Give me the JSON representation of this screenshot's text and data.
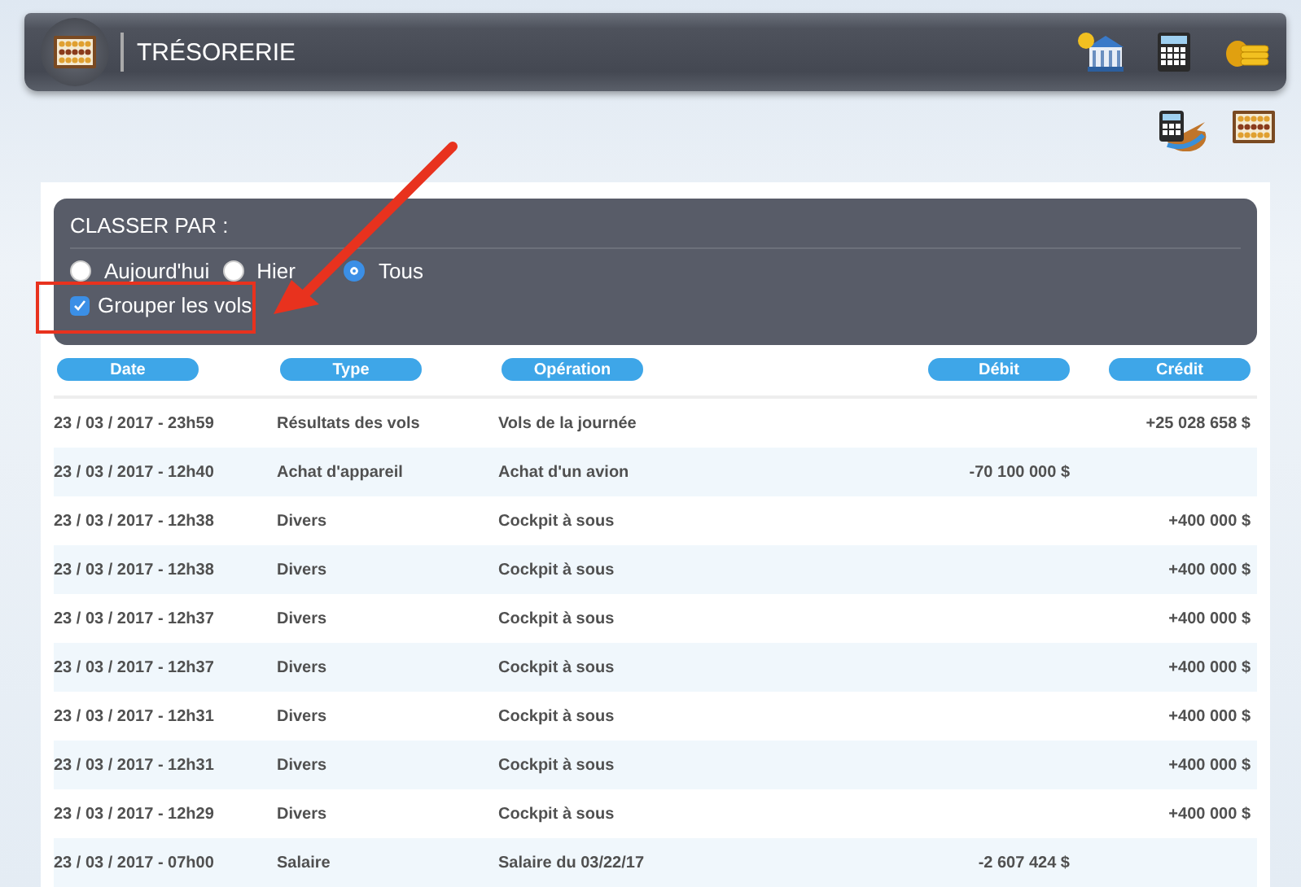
{
  "header": {
    "title": "TRÉSORERIE"
  },
  "filter": {
    "title": "CLASSER PAR :",
    "options": [
      {
        "label": "Aujourd'hui",
        "selected": false
      },
      {
        "label": "Hier",
        "selected": false
      },
      {
        "label": "Tous",
        "selected": true
      }
    ],
    "group_flights": {
      "label": "Grouper les vols",
      "checked": true
    }
  },
  "table": {
    "columns": [
      "Date",
      "Type",
      "Opération",
      "Débit",
      "Crédit"
    ],
    "rows": [
      {
        "date": "23 / 03 / 2017 - 23h59",
        "type": "Résultats des vols",
        "operation": "Vols de la journée",
        "credit": "+25 028 658 $"
      },
      {
        "date": "23 / 03 / 2017 - 12h40",
        "type": "Achat d'appareil",
        "operation": "Achat d'un avion",
        "debit": "-70 100 000 $"
      },
      {
        "date": "23 / 03 / 2017 - 12h38",
        "type": "Divers",
        "operation": "Cockpit à sous",
        "credit": "+400 000 $"
      },
      {
        "date": "23 / 03 / 2017 - 12h38",
        "type": "Divers",
        "operation": "Cockpit à sous",
        "credit": "+400 000 $"
      },
      {
        "date": "23 / 03 / 2017 - 12h37",
        "type": "Divers",
        "operation": "Cockpit à sous",
        "credit": "+400 000 $"
      },
      {
        "date": "23 / 03 / 2017 - 12h37",
        "type": "Divers",
        "operation": "Cockpit à sous",
        "credit": "+400 000 $"
      },
      {
        "date": "23 / 03 / 2017 - 12h31",
        "type": "Divers",
        "operation": "Cockpit à sous",
        "credit": "+400 000 $"
      },
      {
        "date": "23 / 03 / 2017 - 12h31",
        "type": "Divers",
        "operation": "Cockpit à sous",
        "credit": "+400 000 $"
      },
      {
        "date": "23 / 03 / 2017 - 12h29",
        "type": "Divers",
        "operation": "Cockpit à sous",
        "credit": "+400 000 $"
      },
      {
        "date": "23 / 03 / 2017 - 07h00",
        "type": "Salaire",
        "operation": "Salaire du 03/22/17",
        "debit": "-2 607 424 $"
      }
    ]
  }
}
